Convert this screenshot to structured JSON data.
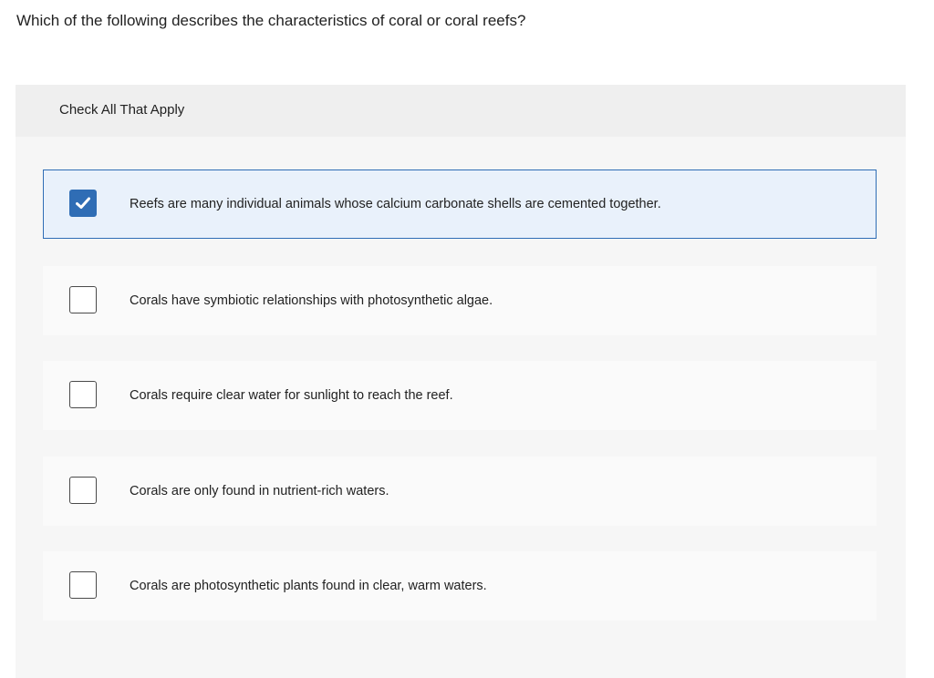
{
  "question": {
    "text": "Which of the following describes the characteristics of coral or coral reefs?"
  },
  "panel": {
    "instruction": "Check All That Apply"
  },
  "choices": [
    {
      "label": "Reefs are many individual animals whose calcium carbonate shells are cemented together.",
      "checked": true
    },
    {
      "label": "Corals have symbiotic relationships with photosynthetic algae.",
      "checked": false
    },
    {
      "label": "Corals require clear water for sunlight to reach the reef.",
      "checked": false
    },
    {
      "label": "Corals are only found in nutrient-rich waters.",
      "checked": false
    },
    {
      "label": "Corals are photosynthetic plants found in clear, warm waters.",
      "checked": false
    }
  ],
  "colors": {
    "accent": "#2f6db5",
    "selected_background": "#e9f1fb",
    "panel_background": "#f6f6f6"
  },
  "icons": {
    "checked": "checkmark-icon"
  }
}
